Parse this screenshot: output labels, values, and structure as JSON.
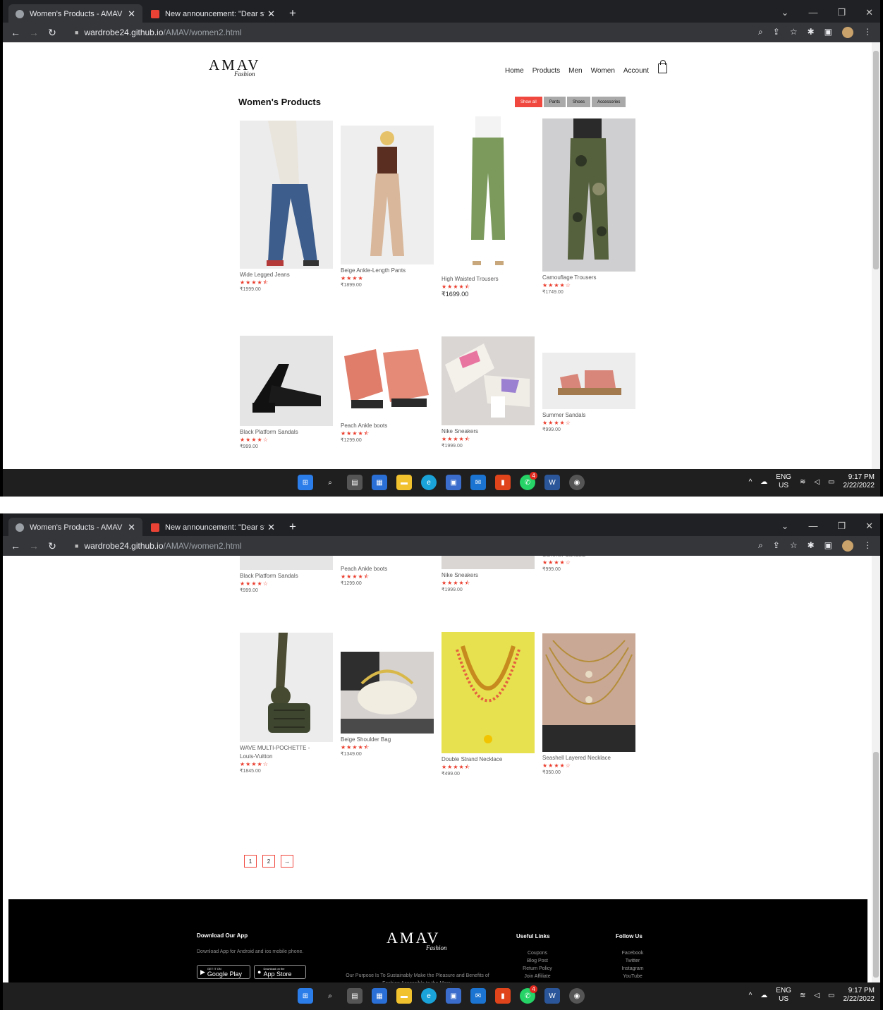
{
  "browser": {
    "tab1": "Women's Products - AMAV",
    "tab2": "New announcement: \"Dear stud",
    "url_host": "wardrobe24.github.io",
    "url_path": "/AMAV/women2.html"
  },
  "site": {
    "logo": "AMAV",
    "logo_script": "Fashion",
    "nav": [
      "Home",
      "Products",
      "Men",
      "Women",
      "Account"
    ],
    "page_title": "Women's Products",
    "filters": [
      "Show all",
      "Pants",
      "Shoes",
      "Accessories"
    ]
  },
  "products": [
    {
      "name": "Wide Legged Jeans",
      "stars": "★★★★⯪",
      "price": "₹1999.00"
    },
    {
      "name": "Beige Ankle-Length Pants",
      "stars": "★★★★",
      "price": "₹1899.00"
    },
    {
      "name": "High Waisted Trousers",
      "stars": "★★★★⯪",
      "price": "₹1699.00"
    },
    {
      "name": "Camouflage Trousers",
      "stars": "★★★★☆",
      "price": "₹1749.00"
    },
    {
      "name": "Black Platform Sandals",
      "stars": "★★★★☆",
      "price": "₹999.00"
    },
    {
      "name": "Peach Ankle boots",
      "stars": "★★★★⯪",
      "price": "₹1299.00"
    },
    {
      "name": "Nike Sneakers",
      "stars": "★★★★⯪",
      "price": "₹1999.00"
    },
    {
      "name": "Summer Sandals",
      "stars": "★★★★☆",
      "price": "₹999.00"
    },
    {
      "name": "WAVE MULTI-POCHETTE - Louis-Vuitton",
      "stars": "★★★★☆",
      "price": "₹1845.00"
    },
    {
      "name": "Beige Shoulder Bag",
      "stars": "★★★★⯪",
      "price": "₹1349.00"
    },
    {
      "name": "Double Strand Necklace",
      "stars": "★★★★⯪",
      "price": "₹499.00"
    },
    {
      "name": "Seashell Layered Necklace",
      "stars": "★★★★☆",
      "price": "₹350.00"
    }
  ],
  "pagination": [
    "1",
    "2",
    "→"
  ],
  "footer": {
    "app_title": "Download Our App",
    "app_text": "Download App for Android and ios mobile phone.",
    "gp_small": "GET IT ON",
    "gp_big": "Google Play",
    "as_small": "Download on the",
    "as_big": "App Store",
    "purpose": "Our Purpose Is To Sustainably Make the Pleasure and Benefits of Fashion Accessible to the Many.",
    "useful_title": "Useful Links",
    "useful": [
      "Coupons",
      "Blog Post",
      "Return Policy",
      "Join Affiliate"
    ],
    "follow_title": "Follow Us",
    "follow": [
      "Facebook",
      "Twitter",
      "Instagram",
      "YouTube"
    ]
  },
  "taskbar": {
    "lang1": "ENG",
    "lang2": "US",
    "time": "9:17 PM",
    "date": "2/22/2022",
    "badge": "4"
  }
}
